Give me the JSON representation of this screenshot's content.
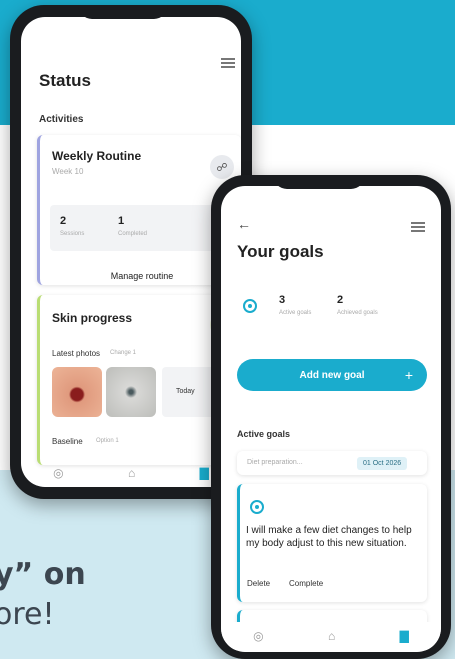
{
  "promo": {
    "line1": "y” on",
    "line2": "ore!"
  },
  "status_screen": {
    "title": "Status",
    "section": "Activities",
    "weekly_card": {
      "title": "Weekly Routine",
      "subtitle": "Week 10",
      "stat1_value": "2",
      "stat1_label": "Sessions",
      "stat2_value": "1",
      "stat2_label": "Completed",
      "link": "Manage routine"
    },
    "skin_card": {
      "title": "Skin progress",
      "latest_label": "Latest photos",
      "latest_sub": "Change 1",
      "today_label": "Today",
      "baseline_label": "Baseline",
      "baseline_sub": "Option 1"
    },
    "nav": [
      "◎",
      "⌂",
      "▇"
    ]
  },
  "goals_screen": {
    "title": "Your goals",
    "back_icon": "←",
    "stat1_value": "3",
    "stat1_label": "Active goals",
    "stat2_value": "2",
    "stat2_label": "Achieved goals",
    "add_button": "Add new goal",
    "add_plus": "+",
    "active_label": "Active goals",
    "goal_input_placeholder": "Diet preparation...",
    "date_badge": "01 Oct 2026",
    "goal_text": "I will make a few diet changes to help my body adjust to this new situation.",
    "delete_label": "Delete",
    "complete_label": "Complete",
    "nav": [
      "◎",
      "⌂",
      "▇"
    ]
  },
  "colors": {
    "accent": "#1aaccd",
    "lavender": "#9fa4e0",
    "lime": "#b9dd73"
  }
}
